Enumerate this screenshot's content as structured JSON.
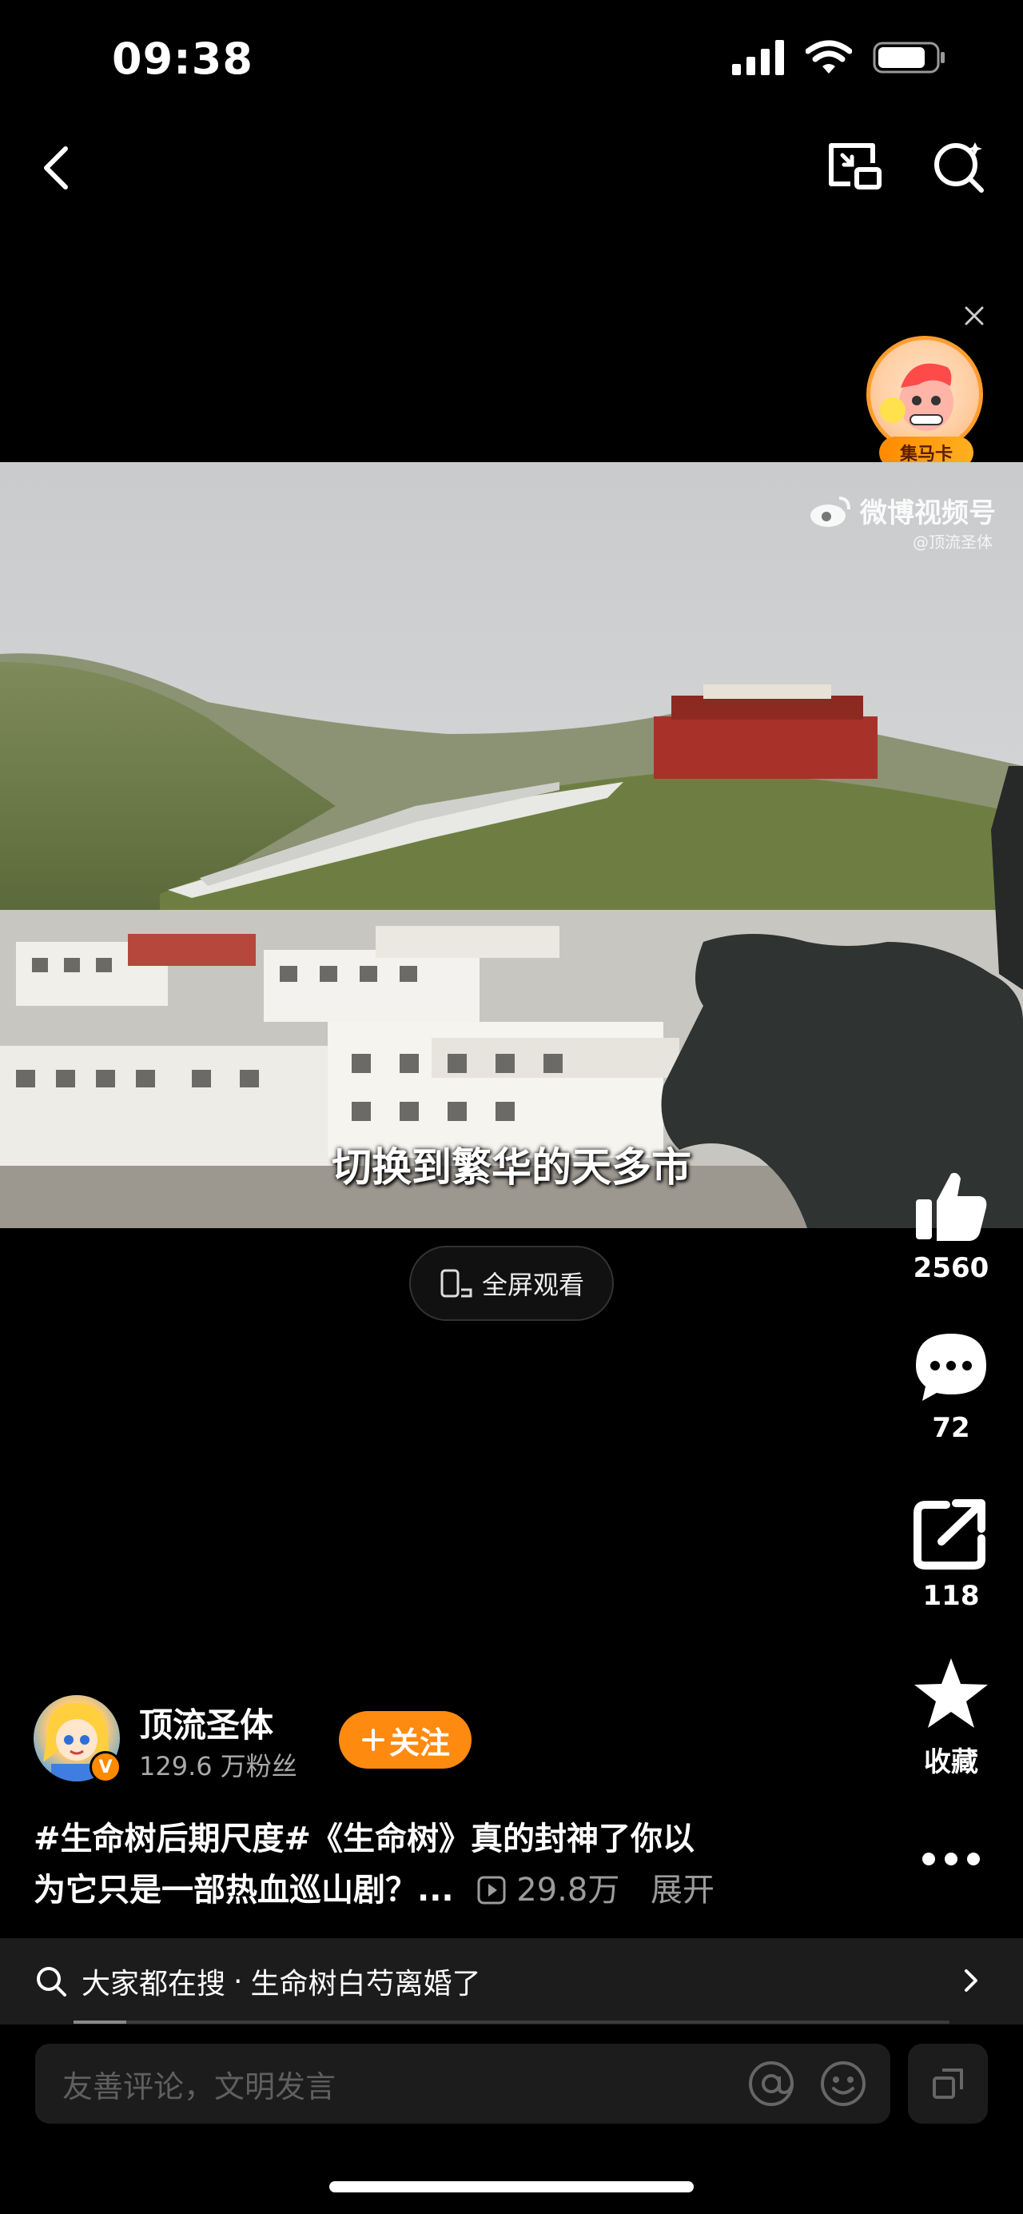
{
  "status_bar": {
    "time": "09:38"
  },
  "promo": {
    "badge_label": "集马卡"
  },
  "video": {
    "watermark_brand": "微博视频号",
    "watermark_handle": "@顶流圣体",
    "subtitle": "切换到繁华的天多市"
  },
  "fullscreen": {
    "label": "全屏观看"
  },
  "actions": {
    "likes": "2560",
    "comments": "72",
    "shares": "118",
    "favorite_label": "收藏"
  },
  "author": {
    "name": "顶流圣体",
    "fans": "129.6 万粉丝",
    "follow_label": "关注",
    "verified_mark": "V"
  },
  "description": {
    "text_line1": "#生命树后期尺度#《生命树》真的封神了你以",
    "text_line2": "为它只是一部热血巡山剧？...",
    "play_count": "29.8万",
    "expand_label": "展开"
  },
  "search_strip": {
    "prefix": "大家都在搜",
    "query": "生命树白芍离婚了"
  },
  "playback": {
    "progress": 0.06
  },
  "comment": {
    "placeholder": "友善评论，文明发言"
  },
  "colors": {
    "accent": "#ff8a10",
    "background": "#000000"
  },
  "icons": [
    "back-icon",
    "pip-icon",
    "search-icon",
    "close-icon",
    "like-icon",
    "comment-icon",
    "share-icon",
    "star-icon",
    "more-icon",
    "chevron-right-icon",
    "at-icon",
    "emoji-icon",
    "expand-icon",
    "phone-rotate-icon",
    "play-count-icon"
  ]
}
